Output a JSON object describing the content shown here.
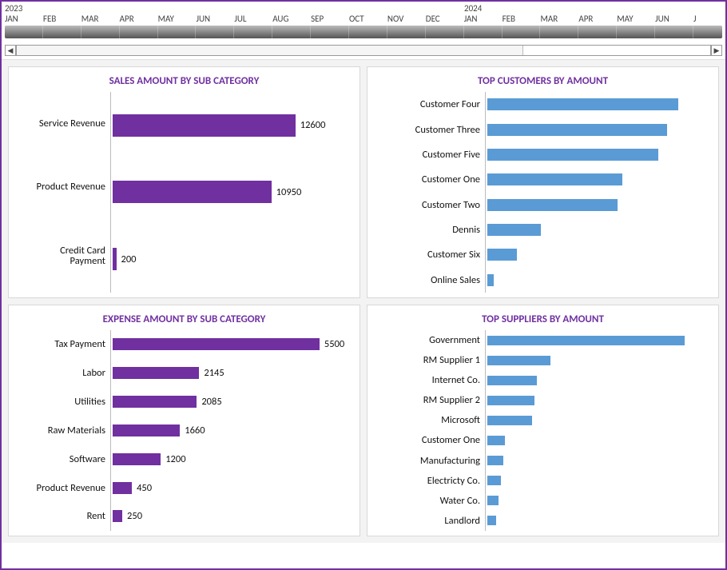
{
  "timeline": {
    "years": [
      "2023",
      "2024"
    ],
    "months": [
      "JAN",
      "FEB",
      "MAR",
      "APR",
      "MAY",
      "JUN",
      "JUL",
      "AUG",
      "SEP",
      "OCT",
      "NOV",
      "DEC",
      "JAN",
      "FEB",
      "MAR",
      "APR",
      "MAY",
      "JUN",
      "J"
    ]
  },
  "cards": {
    "sales": {
      "title": "SALES AMOUNT BY SUB CATEGORY"
    },
    "customers": {
      "title": "TOP CUSTOMERS BY AMOUNT"
    },
    "expense": {
      "title": "EXPENSE AMOUNT BY SUB CATEGORY"
    },
    "suppliers": {
      "title": "TOP SUPPLIERS BY AMOUNT"
    }
  },
  "chart_data": [
    {
      "id": "sales",
      "type": "bar",
      "orientation": "horizontal",
      "title": "SALES AMOUNT BY SUB CATEGORY",
      "color": "#7030A0",
      "categories": [
        "Service Revenue",
        "Product Revenue",
        "Credit Card Payment"
      ],
      "values": [
        12600,
        10950,
        200
      ],
      "value_labels": [
        "12600",
        "10950",
        "200"
      ],
      "xlim": [
        0,
        14500
      ]
    },
    {
      "id": "customers",
      "type": "bar",
      "orientation": "horizontal",
      "title": "TOP CUSTOMERS BY AMOUNT",
      "color": "#5A9BD5",
      "categories": [
        "Customer Four",
        "Customer Three",
        "Customer Five",
        "Customer One",
        "Customer Two",
        "Dennis",
        "Customer Six",
        "Online Sales"
      ],
      "values": [
        5300,
        5000,
        4700,
        3700,
        3600,
        1500,
        800,
        200
      ],
      "xlim": [
        0,
        6200
      ]
    },
    {
      "id": "expense",
      "type": "bar",
      "orientation": "horizontal",
      "title": "EXPENSE AMOUNT BY SUB CATEGORY",
      "color": "#7030A0",
      "categories": [
        "Tax Payment",
        "Labor",
        "Utilities",
        "Raw Materials",
        "Software",
        "Product Revenue",
        "Rent"
      ],
      "values": [
        5500,
        2145,
        2085,
        1660,
        1200,
        450,
        250
      ],
      "value_labels": [
        "5500",
        "2145",
        "2085",
        "1660",
        "1200",
        "450",
        "250"
      ],
      "xlim": [
        0,
        6000
      ]
    },
    {
      "id": "suppliers",
      "type": "bar",
      "orientation": "horizontal",
      "title": "TOP SUPPLIERS BY AMOUNT",
      "color": "#5A9BD5",
      "categories": [
        "Government",
        "RM Supplier 1",
        "Internet Co.",
        "RM Supplier 2",
        "Microsoft",
        "Customer One",
        "Manufacturing",
        "Electricty Co.",
        "Water Co.",
        "Landlord"
      ],
      "values": [
        5500,
        1700,
        1300,
        1250,
        1200,
        500,
        450,
        350,
        300,
        250
      ],
      "xlim": [
        0,
        6000
      ]
    }
  ]
}
